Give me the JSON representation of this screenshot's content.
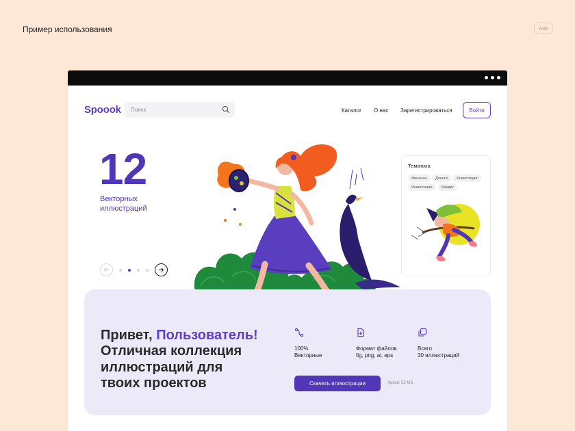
{
  "page": {
    "caption": "Пример использования",
    "badge": "web"
  },
  "header": {
    "logo": "Spoook",
    "search_placeholder": "Поиск",
    "nav": [
      "Каталог",
      "О нас",
      "Зарегистрироваться"
    ],
    "login": "Войти"
  },
  "hero": {
    "count": "12",
    "subtitle": "Векторных иллюстраций",
    "slider": {
      "total": 4,
      "active": 1
    }
  },
  "theme_card": {
    "title": "Тематика",
    "tags": [
      "Финансы",
      "Деньги",
      "Инвестиции",
      "Инвестиции",
      "Кредит"
    ]
  },
  "promo": {
    "greeting": "Привет, ",
    "user": "Пользователь!",
    "heading_rest": "Отличная коллекция иллюстраций для твоих проектов",
    "features": [
      {
        "icon": "vector-icon",
        "line1": "100%",
        "line2": "Векторные"
      },
      {
        "icon": "file-download-icon",
        "line1": "Формат файлов",
        "line2": "fig, png, ai, eps"
      },
      {
        "icon": "copy-icon",
        "line1": "Всего",
        "line2": "30 иллюстраций"
      }
    ],
    "download_button": "Скачать иллюстрации",
    "archive_size": "Архив: 52 МБ"
  },
  "colors": {
    "background": "#fde8d8",
    "accent": "#5236b8",
    "promo_bg": "#ece9f8",
    "bar": "#0b0b0b"
  }
}
